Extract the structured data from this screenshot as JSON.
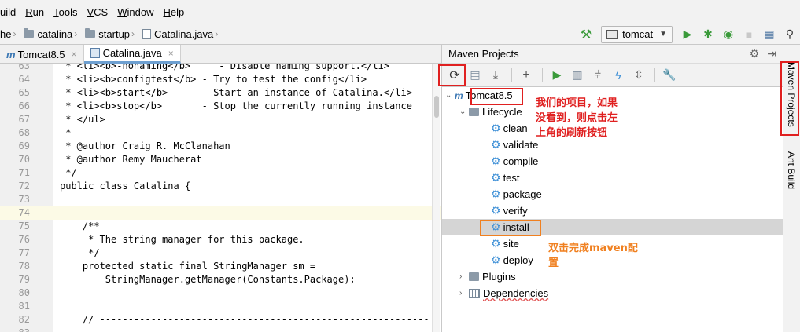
{
  "menu": [
    {
      "label": "uild",
      "mnemonic": ""
    },
    {
      "label": "Run",
      "mnemonic": "R",
      "rest": "un"
    },
    {
      "label": "Tools",
      "mnemonic": "T",
      "rest": "ools"
    },
    {
      "label": "VCS",
      "mnemonic": "V",
      "rest": "CS"
    },
    {
      "label": "Window",
      "mnemonic": "W",
      "rest": "indow"
    },
    {
      "label": "Help",
      "mnemonic": "H",
      "rest": "elp"
    }
  ],
  "breadcrumb": [
    "he",
    "catalina",
    "startup",
    "Catalina.java"
  ],
  "run_config": "tomcat",
  "tabs": [
    {
      "label": "Tomcat8.5",
      "active": false
    },
    {
      "label": "Catalina.java",
      "active": true
    }
  ],
  "editor": {
    "lines": [
      {
        "n": "63",
        "text": " * <li><b>-nonaming</b>     - Disable naming support.</li>"
      },
      {
        "n": "64",
        "text": " * <li><b>configtest</b> - Try to test the config</li>"
      },
      {
        "n": "65",
        "text": " * <li><b>start</b>      - Start an instance of Catalina.</li>"
      },
      {
        "n": "66",
        "text": " * <li><b>stop</b>       - Stop the currently running instance"
      },
      {
        "n": "67",
        "text": " * </ul>"
      },
      {
        "n": "68",
        "text": " *"
      },
      {
        "n": "69",
        "text": " * @author Craig R. McClanahan"
      },
      {
        "n": "70",
        "text": " * @author Remy Maucherat"
      },
      {
        "n": "71",
        "text": " */"
      },
      {
        "n": "72",
        "text": "public class Catalina {"
      },
      {
        "n": "73",
        "text": ""
      },
      {
        "n": "74",
        "text": ""
      },
      {
        "n": "75",
        "text": "    /**"
      },
      {
        "n": "76",
        "text": "     * The string manager for this package."
      },
      {
        "n": "77",
        "text": "     */"
      },
      {
        "n": "78",
        "text": "    protected static final StringManager sm ="
      },
      {
        "n": "79",
        "text": "        StringManager.getManager(Constants.Package);"
      },
      {
        "n": "80",
        "text": ""
      },
      {
        "n": "81",
        "text": ""
      },
      {
        "n": "82",
        "text": "    // ----------------------------------------------------------"
      },
      {
        "n": "83",
        "text": ""
      }
    ]
  },
  "maven": {
    "title": "Maven Projects",
    "project": "Tomcat8.5",
    "lifecycle_label": "Lifecycle",
    "goals": [
      "clean",
      "validate",
      "compile",
      "test",
      "package",
      "verify",
      "install",
      "site",
      "deploy"
    ],
    "selected_goal": "install",
    "plugins_label": "Plugins",
    "dependencies_label": "Dependencies"
  },
  "side_tabs": {
    "maven": "Maven Projects",
    "ant": "Ant Build"
  },
  "annotations": {
    "refresh_note_lines": [
      "我们的项目，如果",
      "没看到，则点击左",
      "上角的刷新按钮"
    ],
    "install_note_lines": [
      "双击完成maven配",
      "置"
    ]
  },
  "colors": {
    "annotation_red": "#e02020",
    "annotation_orange": "#f08020",
    "run_green": "#3a9a3a",
    "gear_blue": "#3d8fd6"
  }
}
